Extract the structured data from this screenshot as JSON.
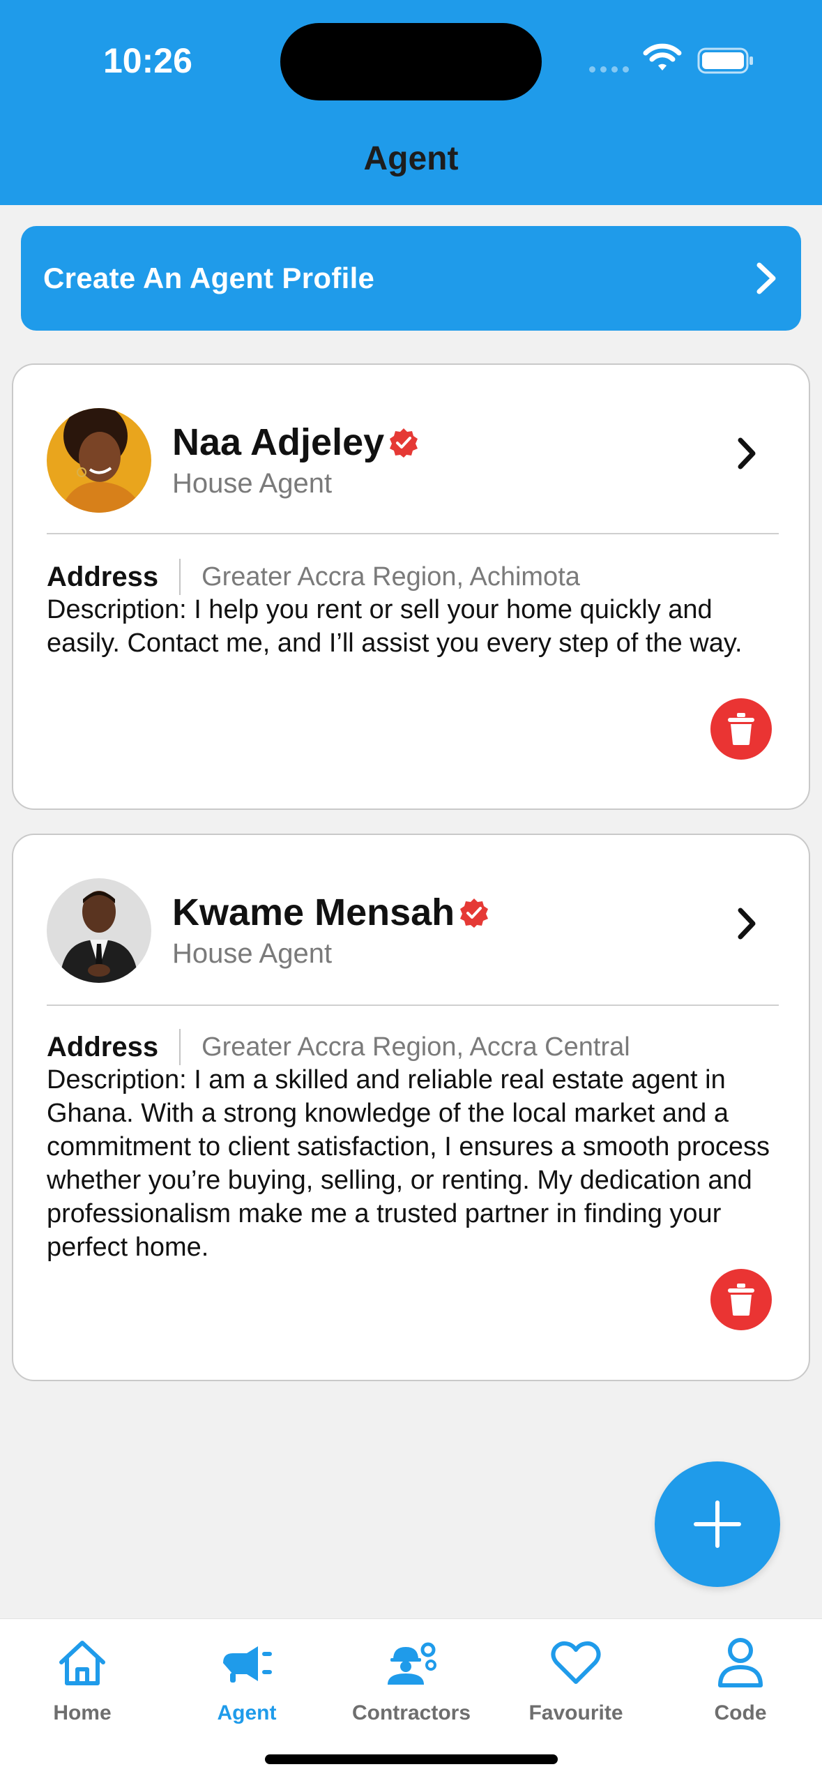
{
  "status_bar": {
    "time": "10:26"
  },
  "header": {
    "title": "Agent"
  },
  "create_profile": {
    "label": "Create An Agent Profile"
  },
  "agents": [
    {
      "name": "Naa Adjeley",
      "role": "House Agent",
      "address_label": "Address",
      "address": "Greater Accra Region, Achimota",
      "description": "Description: I help you rent or sell your home quickly and easily. Contact me, and I’ll assist you every step of the way."
    },
    {
      "name": "Kwame Mensah",
      "role": "House Agent",
      "address_label": "Address",
      "address": "Greater Accra Region, Accra Central",
      "description": "Description: I am a skilled and reliable real estate agent in Ghana. With a strong knowledge of the local market and a commitment to client satisfaction, I ensures a smooth process whether you’re buying, selling, or renting. My dedication and professionalism make me a trusted partner in finding your perfect home."
    }
  ],
  "tabs": [
    {
      "label": "Home",
      "icon": "home-icon",
      "active": false
    },
    {
      "label": "Agent",
      "icon": "megaphone-icon",
      "active": true
    },
    {
      "label": "Contractors",
      "icon": "contractor-icon",
      "active": false
    },
    {
      "label": "Favourite",
      "icon": "heart-icon",
      "active": false
    },
    {
      "label": "Code",
      "icon": "user-icon",
      "active": false
    }
  ],
  "colors": {
    "primary": "#1f9bea",
    "danger": "#ea3433",
    "verified": "#e53935"
  }
}
